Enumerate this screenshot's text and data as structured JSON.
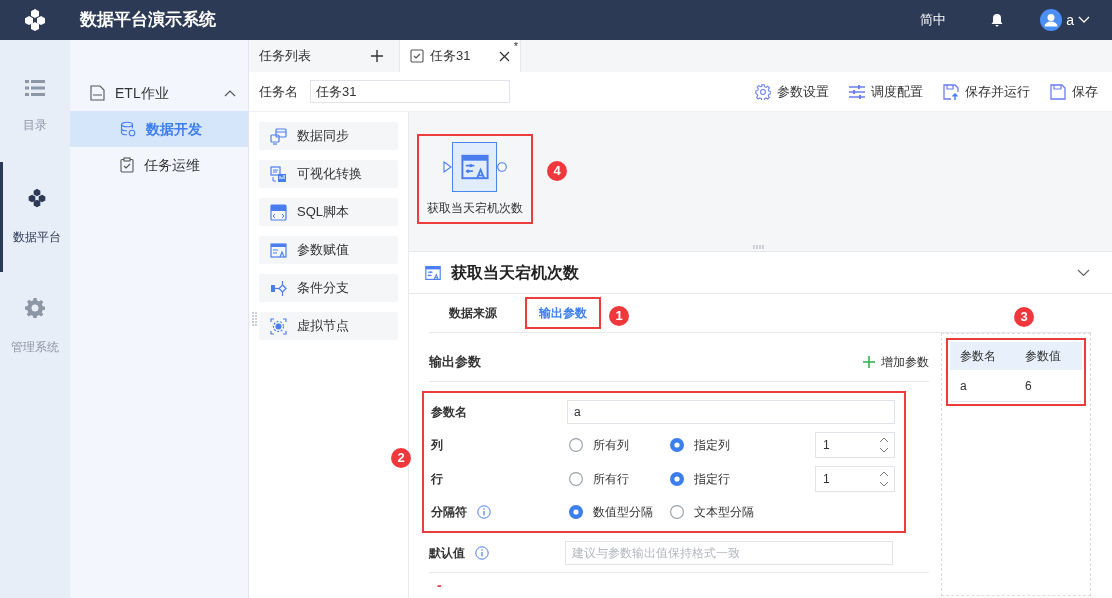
{
  "app": {
    "title": "数据平台演示系统",
    "language": "简中",
    "user": "a"
  },
  "nav": [
    {
      "label": "目录",
      "kind": "list",
      "selected": false
    },
    {
      "label": "数据平台",
      "kind": "cubes",
      "selected": true
    },
    {
      "label": "管理系统",
      "kind": "gear",
      "selected": false
    }
  ],
  "sidebar": {
    "label": "ETL作业",
    "expanded": true,
    "children": [
      {
        "label": "数据开发",
        "kind": "db",
        "selected": true
      },
      {
        "label": "任务运维",
        "kind": "clip",
        "selected": false
      }
    ]
  },
  "tabs": [
    {
      "label": "任务列表",
      "kind": "list",
      "selected": false
    },
    {
      "label": "任务31",
      "kind": "task",
      "selected": true,
      "modified_mark": "*"
    }
  ],
  "toolbar": {
    "task_name_label": "任务名",
    "task_name": "任务31",
    "actions": [
      {
        "label": "参数设置",
        "kind": "gear"
      },
      {
        "label": "调度配置",
        "kind": "sliders"
      },
      {
        "label": "保存并运行",
        "kind": "save_run"
      },
      {
        "label": "保存",
        "kind": "save"
      }
    ]
  },
  "palette": [
    {
      "label": "数据同步",
      "kind": "sync"
    },
    {
      "label": "可视化转换",
      "kind": "visual"
    },
    {
      "label": "SQL脚本",
      "kind": "sql"
    },
    {
      "label": "参数赋值",
      "kind": "param"
    },
    {
      "label": "条件分支",
      "kind": "branch"
    },
    {
      "label": "虚拟节点",
      "kind": "virtual"
    }
  ],
  "canvas": {
    "node": {
      "label": "获取当天宕机次数",
      "selected": true
    }
  },
  "panel": {
    "title": "获取当天宕机次数",
    "tabs": [
      {
        "label": "数据来源",
        "selected": false
      },
      {
        "label": "输出参数",
        "selected": true
      }
    ],
    "section_title": "输出参数",
    "add_label": "增加参数",
    "fields": [
      {
        "kind": "text",
        "label": "参数名",
        "value": "a"
      },
      {
        "kind": "radio_spin",
        "label": "列",
        "options": [
          {
            "label": "所有列",
            "selected": false
          },
          {
            "label": "指定列",
            "selected": true
          }
        ],
        "value": "1"
      },
      {
        "kind": "radio_spin",
        "label": "行",
        "options": [
          {
            "label": "所有行",
            "selected": false
          },
          {
            "label": "指定行",
            "selected": true
          }
        ],
        "value": "1"
      },
      {
        "kind": "radio",
        "label": "分隔符",
        "info": true,
        "options": [
          {
            "label": "数值型分隔",
            "selected": true
          },
          {
            "label": "文本型分隔",
            "selected": false
          }
        ]
      }
    ],
    "default_field": {
      "label": "默认值",
      "info": true,
      "placeholder": "建议与参数输出值保持格式一致"
    },
    "remove_mark": "-",
    "results": {
      "columns": [
        "参数名",
        "参数值"
      ],
      "rows": [
        [
          "a",
          "6"
        ]
      ]
    }
  },
  "annotations": [
    {
      "label": "1",
      "kind": "tab"
    },
    {
      "label": "2",
      "kind": "form"
    },
    {
      "label": "3",
      "kind": "results"
    },
    {
      "label": "4",
      "kind": "node"
    }
  ]
}
